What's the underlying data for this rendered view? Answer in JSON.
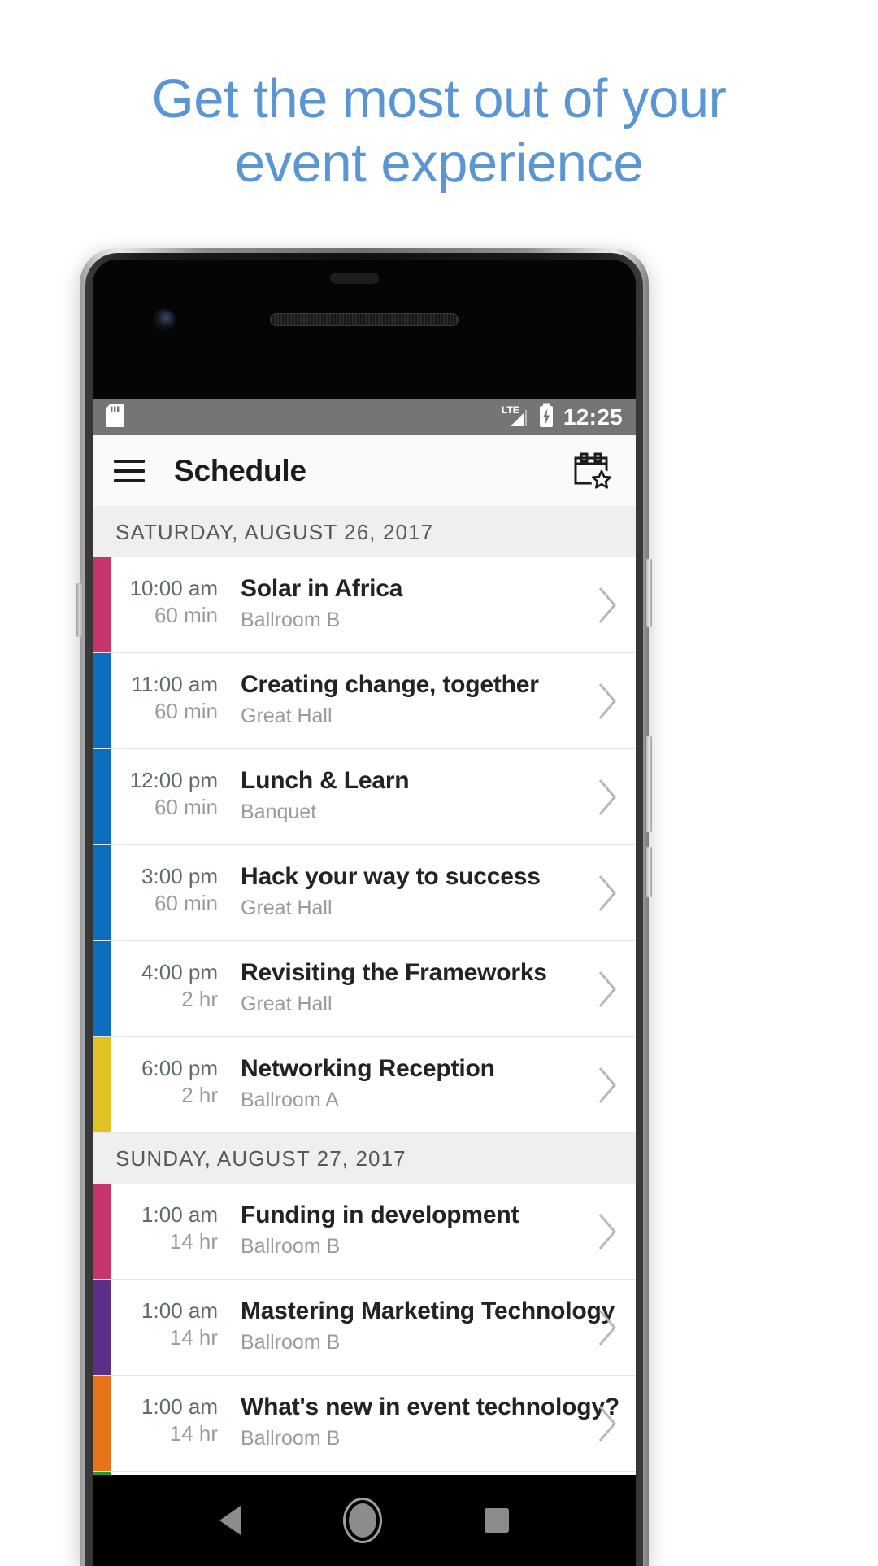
{
  "headline": {
    "line1": "Get the most out of your",
    "line2": "event experience",
    "color": "#5a95d4"
  },
  "device": {
    "statusbar": {
      "sd_icon": "sd-card-icon",
      "network_label": "LTE",
      "signal_icon": "signal-bars-icon",
      "battery_icon": "battery-charging-icon",
      "time": "12:25",
      "background": "#757575"
    },
    "navbar": {
      "back": "back-triangle-icon",
      "home": "home-circle-icon",
      "recents": "recents-square-icon"
    }
  },
  "appbar": {
    "menu_icon": "hamburger-menu-icon",
    "title": "Schedule",
    "action_icon": "calendar-star-icon"
  },
  "schedule": {
    "sections": [
      {
        "date": "SATURDAY, AUGUST 26, 2017",
        "rows": [
          {
            "time": "10:00 am",
            "duration": "60 min",
            "title": "Solar in Africa",
            "location": "Ballroom B",
            "color": "#c6356c"
          },
          {
            "time": "11:00 am",
            "duration": "60 min",
            "title": "Creating change, together",
            "location": "Great Hall",
            "color": "#0d6ebd"
          },
          {
            "time": "12:00 pm",
            "duration": "60 min",
            "title": "Lunch & Learn",
            "location": "Banquet",
            "color": "#0d6ebd"
          },
          {
            "time": "3:00 pm",
            "duration": "60 min",
            "title": "Hack your way to success",
            "location": "Great Hall",
            "color": "#0d6ebd"
          },
          {
            "time": "4:00 pm",
            "duration": "2 hr",
            "title": "Revisiting the Frameworks",
            "location": "Great Hall",
            "color": "#0d6ebd"
          },
          {
            "time": "6:00 pm",
            "duration": "2 hr",
            "title": "Networking Reception",
            "location": "Ballroom A",
            "color": "#e2c223"
          }
        ]
      },
      {
        "date": "SUNDAY, AUGUST 27, 2017",
        "rows": [
          {
            "time": "1:00 am",
            "duration": "14 hr",
            "title": "Funding in development",
            "location": "Ballroom B",
            "color": "#c6356c"
          },
          {
            "time": "1:00 am",
            "duration": "14 hr",
            "title": "Mastering Marketing Technology",
            "location": "Ballroom B",
            "color": "#5b3089"
          },
          {
            "time": "1:00 am",
            "duration": "14 hr",
            "title": "What's new in event technology?",
            "location": "Ballroom B",
            "color": "#e8741a"
          },
          {
            "time": "",
            "duration": "",
            "title": "",
            "location": "",
            "color": "#199a3c"
          }
        ]
      }
    ]
  }
}
